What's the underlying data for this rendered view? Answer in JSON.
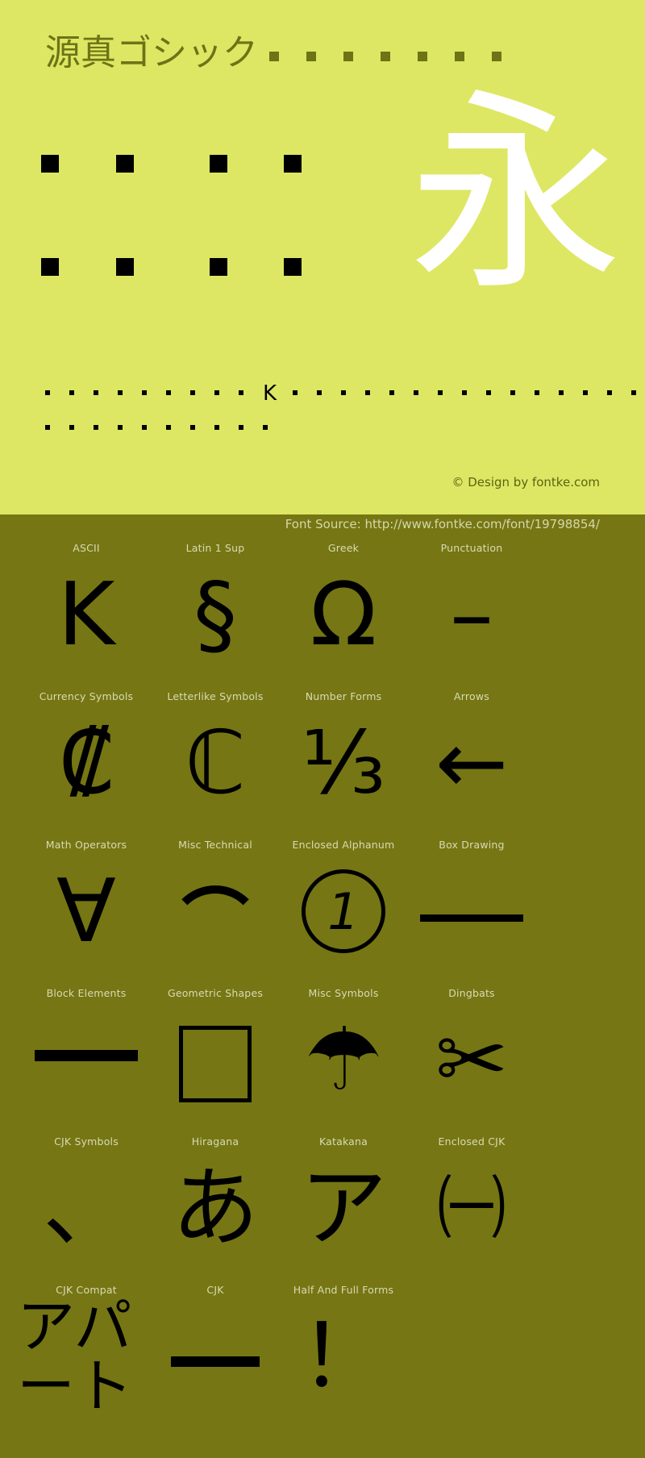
{
  "hero": {
    "title": "源真ゴシック",
    "title_tofu_count": 7,
    "big_sample": "永",
    "big_tofu_rows": 2,
    "big_tofu_per_row": 4,
    "mini_line_1": {
      "before_k": 9,
      "k": "K",
      "after_k": 15
    },
    "mini_line_2": {
      "count": 10
    },
    "credit": "© Design by fontke.com",
    "bg_color": "#dde763",
    "title_color": "#6e7316",
    "sample_color": "#ffffff"
  },
  "source": {
    "text": "Font Source: http://www.fontke.com/font/19798854/",
    "bg_color": "#767614",
    "text_color": "#d5d8a8"
  },
  "grid": {
    "bg_color": "#767614",
    "label_color": "#d8dbb4",
    "glyph_color": "#000000",
    "rows": [
      [
        {
          "label": "ASCII",
          "glyph": "K",
          "render": "text"
        },
        {
          "label": "Latin 1 Sup",
          "glyph": "§",
          "render": "text"
        },
        {
          "label": "Greek",
          "glyph": "Ω",
          "render": "text"
        },
        {
          "label": "Punctuation",
          "glyph": "–",
          "render": "text"
        }
      ],
      [
        {
          "label": "Currency Symbols",
          "glyph": "₡",
          "render": "text"
        },
        {
          "label": "Letterlike Symbols",
          "glyph": "ℂ",
          "render": "text"
        },
        {
          "label": "Number Forms",
          "glyph": "⅓",
          "render": "text"
        },
        {
          "label": "Arrows",
          "glyph": "←",
          "render": "text"
        }
      ],
      [
        {
          "label": "Math Operators",
          "glyph": "∀",
          "render": "text"
        },
        {
          "label": "Misc Technical",
          "glyph": "⌒",
          "render": "arc"
        },
        {
          "label": "Enclosed Alphanum",
          "glyph": "①",
          "render": "circle-one"
        },
        {
          "label": "Box Drawing",
          "glyph": "─",
          "render": "dash"
        }
      ],
      [
        {
          "label": "Block Elements",
          "glyph": "▀",
          "render": "block"
        },
        {
          "label": "Geometric Shapes",
          "glyph": "□",
          "render": "box"
        },
        {
          "label": "Misc Symbols",
          "glyph": "☂",
          "render": "text"
        },
        {
          "label": "Dingbats",
          "glyph": "✂",
          "render": "text"
        }
      ],
      [
        {
          "label": "CJK Symbols",
          "glyph": "、",
          "render": "text"
        },
        {
          "label": "Hiragana",
          "glyph": "あ",
          "render": "text"
        },
        {
          "label": "Katakana",
          "glyph": "ア",
          "render": "text"
        },
        {
          "label": "Enclosed CJK",
          "glyph": "㈠",
          "render": "text"
        }
      ],
      [
        {
          "label": "CJK Compat",
          "glyph": "アパート",
          "render": "wrap"
        },
        {
          "label": "CJK",
          "glyph": "一",
          "render": "cjkdash"
        },
        {
          "label": "Half And Full Forms",
          "glyph": "！",
          "render": "text"
        }
      ]
    ]
  }
}
